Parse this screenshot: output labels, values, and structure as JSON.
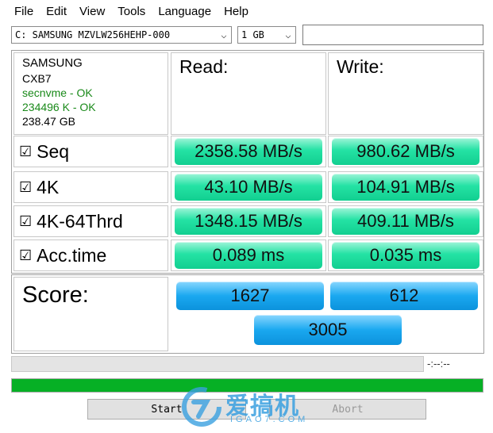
{
  "menu": [
    "File",
    "Edit",
    "View",
    "Tools",
    "Language",
    "Help"
  ],
  "controls": {
    "drive": "C: SAMSUNG MZVLW256HEHP-000",
    "size": "1 GB",
    "text_value": ""
  },
  "drive_info": {
    "brand": "SAMSUNG",
    "firmware": "CXB7",
    "driver": "secnvme - OK",
    "alignment": "234496 K - OK",
    "capacity": "238.47 GB"
  },
  "headers": {
    "read": "Read:",
    "write": "Write:"
  },
  "rows": [
    {
      "label": "Seq",
      "checked": "☑",
      "read": "2358.58 MB/s",
      "write": "980.62 MB/s"
    },
    {
      "label": "4K",
      "checked": "☑",
      "read": "43.10 MB/s",
      "write": "104.91 MB/s"
    },
    {
      "label": "4K-64Thrd",
      "checked": "☑",
      "read": "1348.15 MB/s",
      "write": "409.11 MB/s"
    },
    {
      "label": "Acc.time",
      "checked": "☑",
      "read": "0.089 ms",
      "write": "0.035 ms"
    }
  ],
  "score": {
    "label": "Score:",
    "read": "1627",
    "write": "612",
    "total": "3005"
  },
  "progress": {
    "time": "-:--:--",
    "fill_fraction": 1.0
  },
  "buttons": {
    "start": "Start",
    "abort": "Abort"
  },
  "watermark": {
    "text": "爱搞机",
    "sub": "IGAO7.COM"
  },
  "colors": {
    "pill_green": "#24e2a4",
    "pill_blue": "#1aa8f0",
    "progress_green": "#06b025"
  }
}
